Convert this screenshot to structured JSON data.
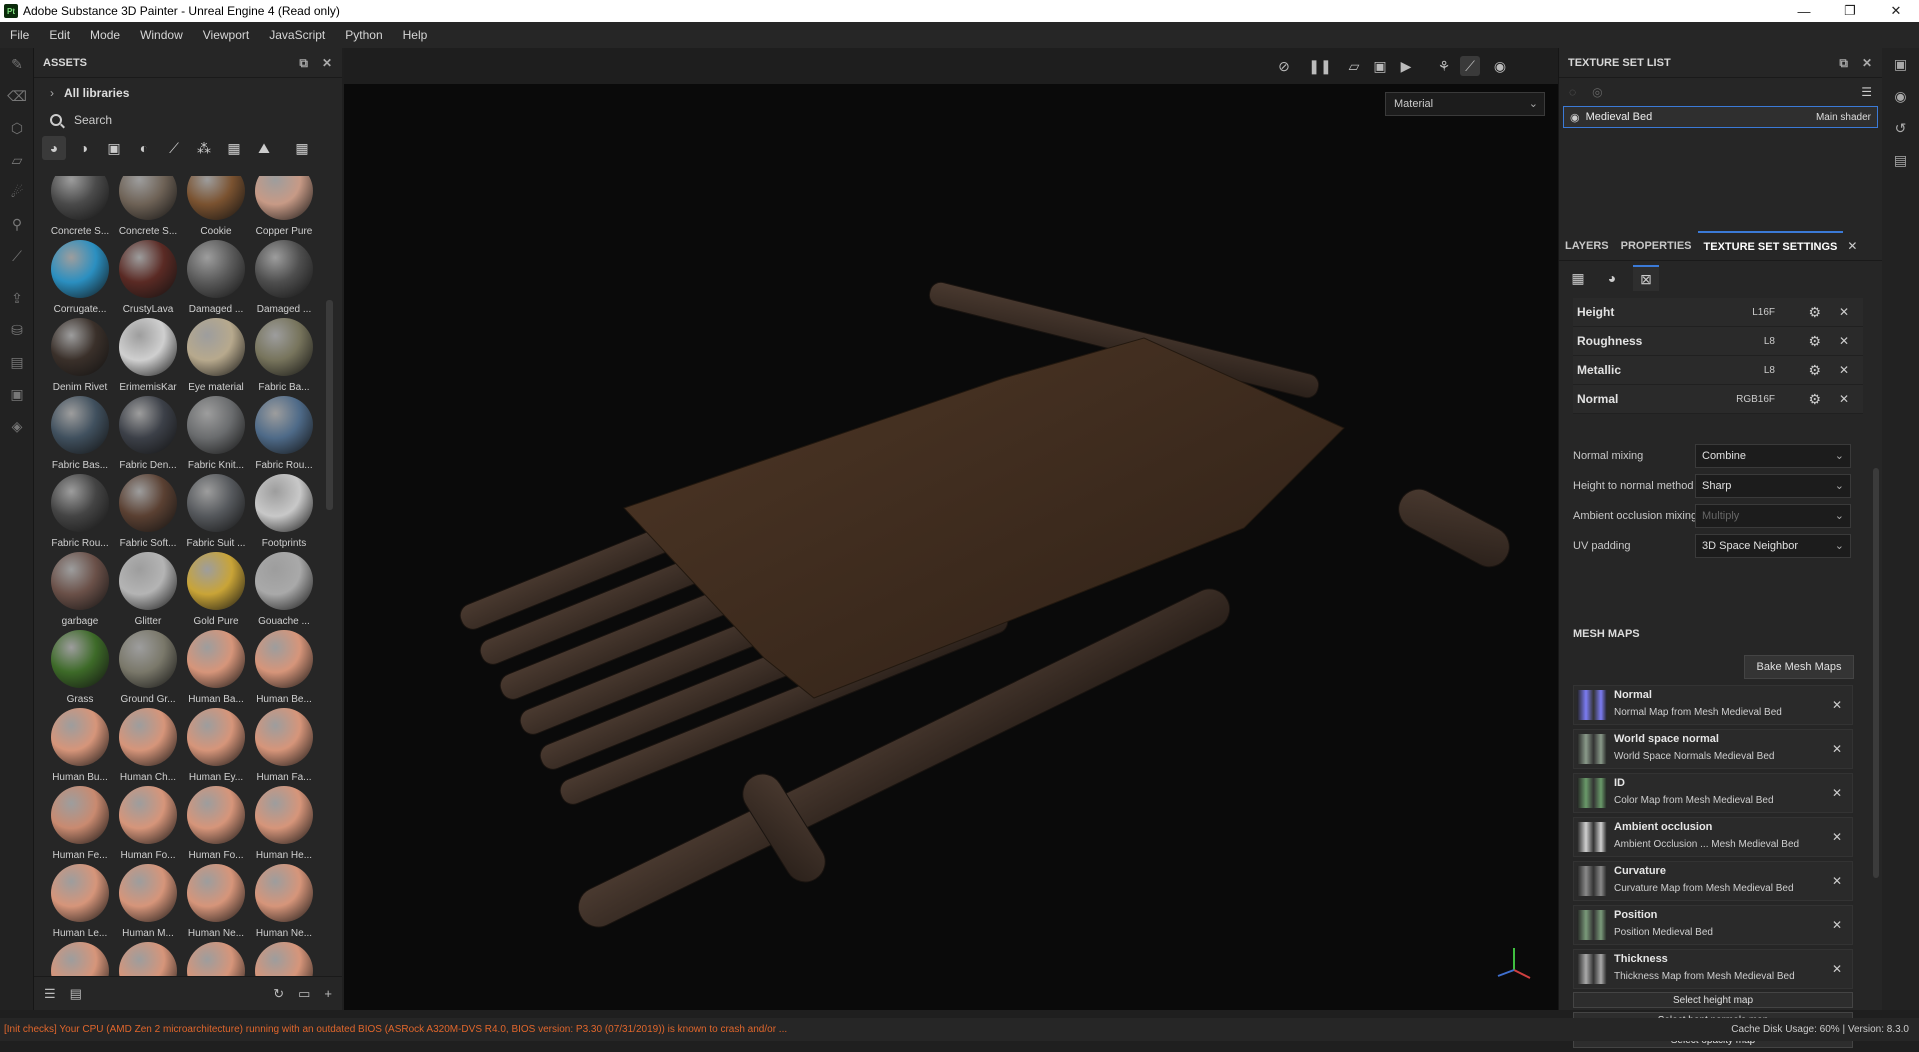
{
  "window": {
    "app_icon": "Pt",
    "title": "Adobe Substance 3D Painter - Unreal Engine 4 (Read only)",
    "minimize": "—",
    "maximize": "❐",
    "close": "✕"
  },
  "menu": [
    "File",
    "Edit",
    "Mode",
    "Window",
    "Viewport",
    "JavaScript",
    "Python",
    "Help"
  ],
  "assets_panel": {
    "title": "ASSETS",
    "libraries_label": "All libraries",
    "search_placeholder": "Search",
    "items": [
      {
        "label": "Concrete S...",
        "color": "#4a4a4a"
      },
      {
        "label": "Concrete S...",
        "color": "#6e6256"
      },
      {
        "label": "Cookie",
        "color": "#7a5230"
      },
      {
        "label": "Copper Pure",
        "color": "#c79a86"
      },
      {
        "label": "Corrugate...",
        "color": "#2b8fc0"
      },
      {
        "label": "CrustyLava",
        "color": "#5a2a24"
      },
      {
        "label": "Damaged ...",
        "color": "#5a5a5a"
      },
      {
        "label": "Damaged ...",
        "color": "#4e4e4e"
      },
      {
        "label": "Denim Rivet",
        "color": "#3a302a"
      },
      {
        "label": "ErimemisKar",
        "color": "#cfcfcf"
      },
      {
        "label": "Eye material",
        "color": "#b7a98d"
      },
      {
        "label": "Fabric Ba...",
        "color": "#77745c"
      },
      {
        "label": "Fabric Bas...",
        "color": "#40505e"
      },
      {
        "label": "Fabric Den...",
        "color": "#3c4048"
      },
      {
        "label": "Fabric Knit...",
        "color": "#6a6c6e"
      },
      {
        "label": "Fabric Rou...",
        "color": "#4e6a88"
      },
      {
        "label": "Fabric Rou...",
        "color": "#444"
      },
      {
        "label": "Fabric Soft...",
        "color": "#5a4032"
      },
      {
        "label": "Fabric Suit ...",
        "color": "#55585c"
      },
      {
        "label": "Footprints",
        "color": "#c8c8c8"
      },
      {
        "label": "garbage",
        "color": "#6a5048"
      },
      {
        "label": "Glitter",
        "color": "#b4b4b4"
      },
      {
        "label": "Gold Pure",
        "color": "#c9a437"
      },
      {
        "label": "Gouache ...",
        "color": "#a9a9a9"
      },
      {
        "label": "Grass",
        "color": "#3d6a28"
      },
      {
        "label": "Ground Gr...",
        "color": "#7a786a"
      },
      {
        "label": "Human Ba...",
        "color": "#d6957a"
      },
      {
        "label": "Human Be...",
        "color": "#d6957a"
      },
      {
        "label": "Human Bu...",
        "color": "#d6957a"
      },
      {
        "label": "Human Ch...",
        "color": "#d6957a"
      },
      {
        "label": "Human Ey...",
        "color": "#d6957a"
      },
      {
        "label": "Human Fa...",
        "color": "#d6957a"
      },
      {
        "label": "Human Fe...",
        "color": "#c98a70"
      },
      {
        "label": "Human Fo...",
        "color": "#d6957a"
      },
      {
        "label": "Human Fo...",
        "color": "#d6957a"
      },
      {
        "label": "Human He...",
        "color": "#d6957a"
      },
      {
        "label": "Human Le...",
        "color": "#d6957a"
      },
      {
        "label": "Human M...",
        "color": "#d6957a"
      },
      {
        "label": "Human Ne...",
        "color": "#d6957a"
      },
      {
        "label": "Human Ne...",
        "color": "#d6957a"
      },
      {
        "label": "",
        "color": "#d6957a"
      },
      {
        "label": "",
        "color": "#d6957a"
      },
      {
        "label": "",
        "color": "#d6957a"
      },
      {
        "label": "",
        "color": "#d6957a"
      }
    ]
  },
  "viewport": {
    "mode_select": "Material"
  },
  "texture_set_list": {
    "title": "TEXTURE SET LIST",
    "item_name": "Medieval Bed",
    "item_shader": "Main shader"
  },
  "tabs": {
    "layers": "LAYERS",
    "properties": "PROPERTIES",
    "texture_set_settings": "TEXTURE SET SETTINGS"
  },
  "channels": [
    {
      "name": "Height",
      "format": "L16F"
    },
    {
      "name": "Roughness",
      "format": "L8"
    },
    {
      "name": "Metallic",
      "format": "L8"
    },
    {
      "name": "Normal",
      "format": "RGB16F"
    }
  ],
  "settings": [
    {
      "label": "Normal mixing",
      "value": "Combine",
      "disabled": false
    },
    {
      "label": "Height to normal method",
      "value": "Sharp",
      "disabled": false
    },
    {
      "label": "Ambient occlusion mixing",
      "value": "Multiply",
      "disabled": true
    },
    {
      "label": "UV padding",
      "value": "3D Space Neighbor",
      "disabled": false
    }
  ],
  "mesh_maps": {
    "title": "MESH MAPS",
    "bake_button": "Bake Mesh Maps",
    "items": [
      {
        "name": "Normal",
        "source": "Normal Map from Mesh Medieval Bed",
        "color": "#7c7cf4"
      },
      {
        "name": "World space normal",
        "source": "World Space Normals Medieval Bed",
        "color": "#8a9a8a"
      },
      {
        "name": "ID",
        "source": "Color Map from Mesh Medieval Bed",
        "color": "#6a9a6a"
      },
      {
        "name": "Ambient occlusion",
        "source": "Ambient Occlusion ... Mesh Medieval Bed",
        "color": "#d0d0d0"
      },
      {
        "name": "Curvature",
        "source": "Curvature Map from Mesh Medieval Bed",
        "color": "#8a8a8a"
      },
      {
        "name": "Position",
        "source": "Position Medieval Bed",
        "color": "#7a9a7a"
      },
      {
        "name": "Thickness",
        "source": "Thickness Map from Mesh Medieval Bed",
        "color": "#aaaaaa"
      }
    ],
    "select_buttons": [
      "Select height map",
      "Select bent normals map",
      "Select opacity map"
    ]
  },
  "status": {
    "warning": "[Init checks] Your CPU (AMD Zen 2 microarchitecture) running with an outdated BIOS (ASRock A320M-DVS R4.0, BIOS version: P3.30 (07/31/2019)) is known to crash and/or ...",
    "right": "Cache Disk Usage:   60% | Version: 8.3.0"
  }
}
